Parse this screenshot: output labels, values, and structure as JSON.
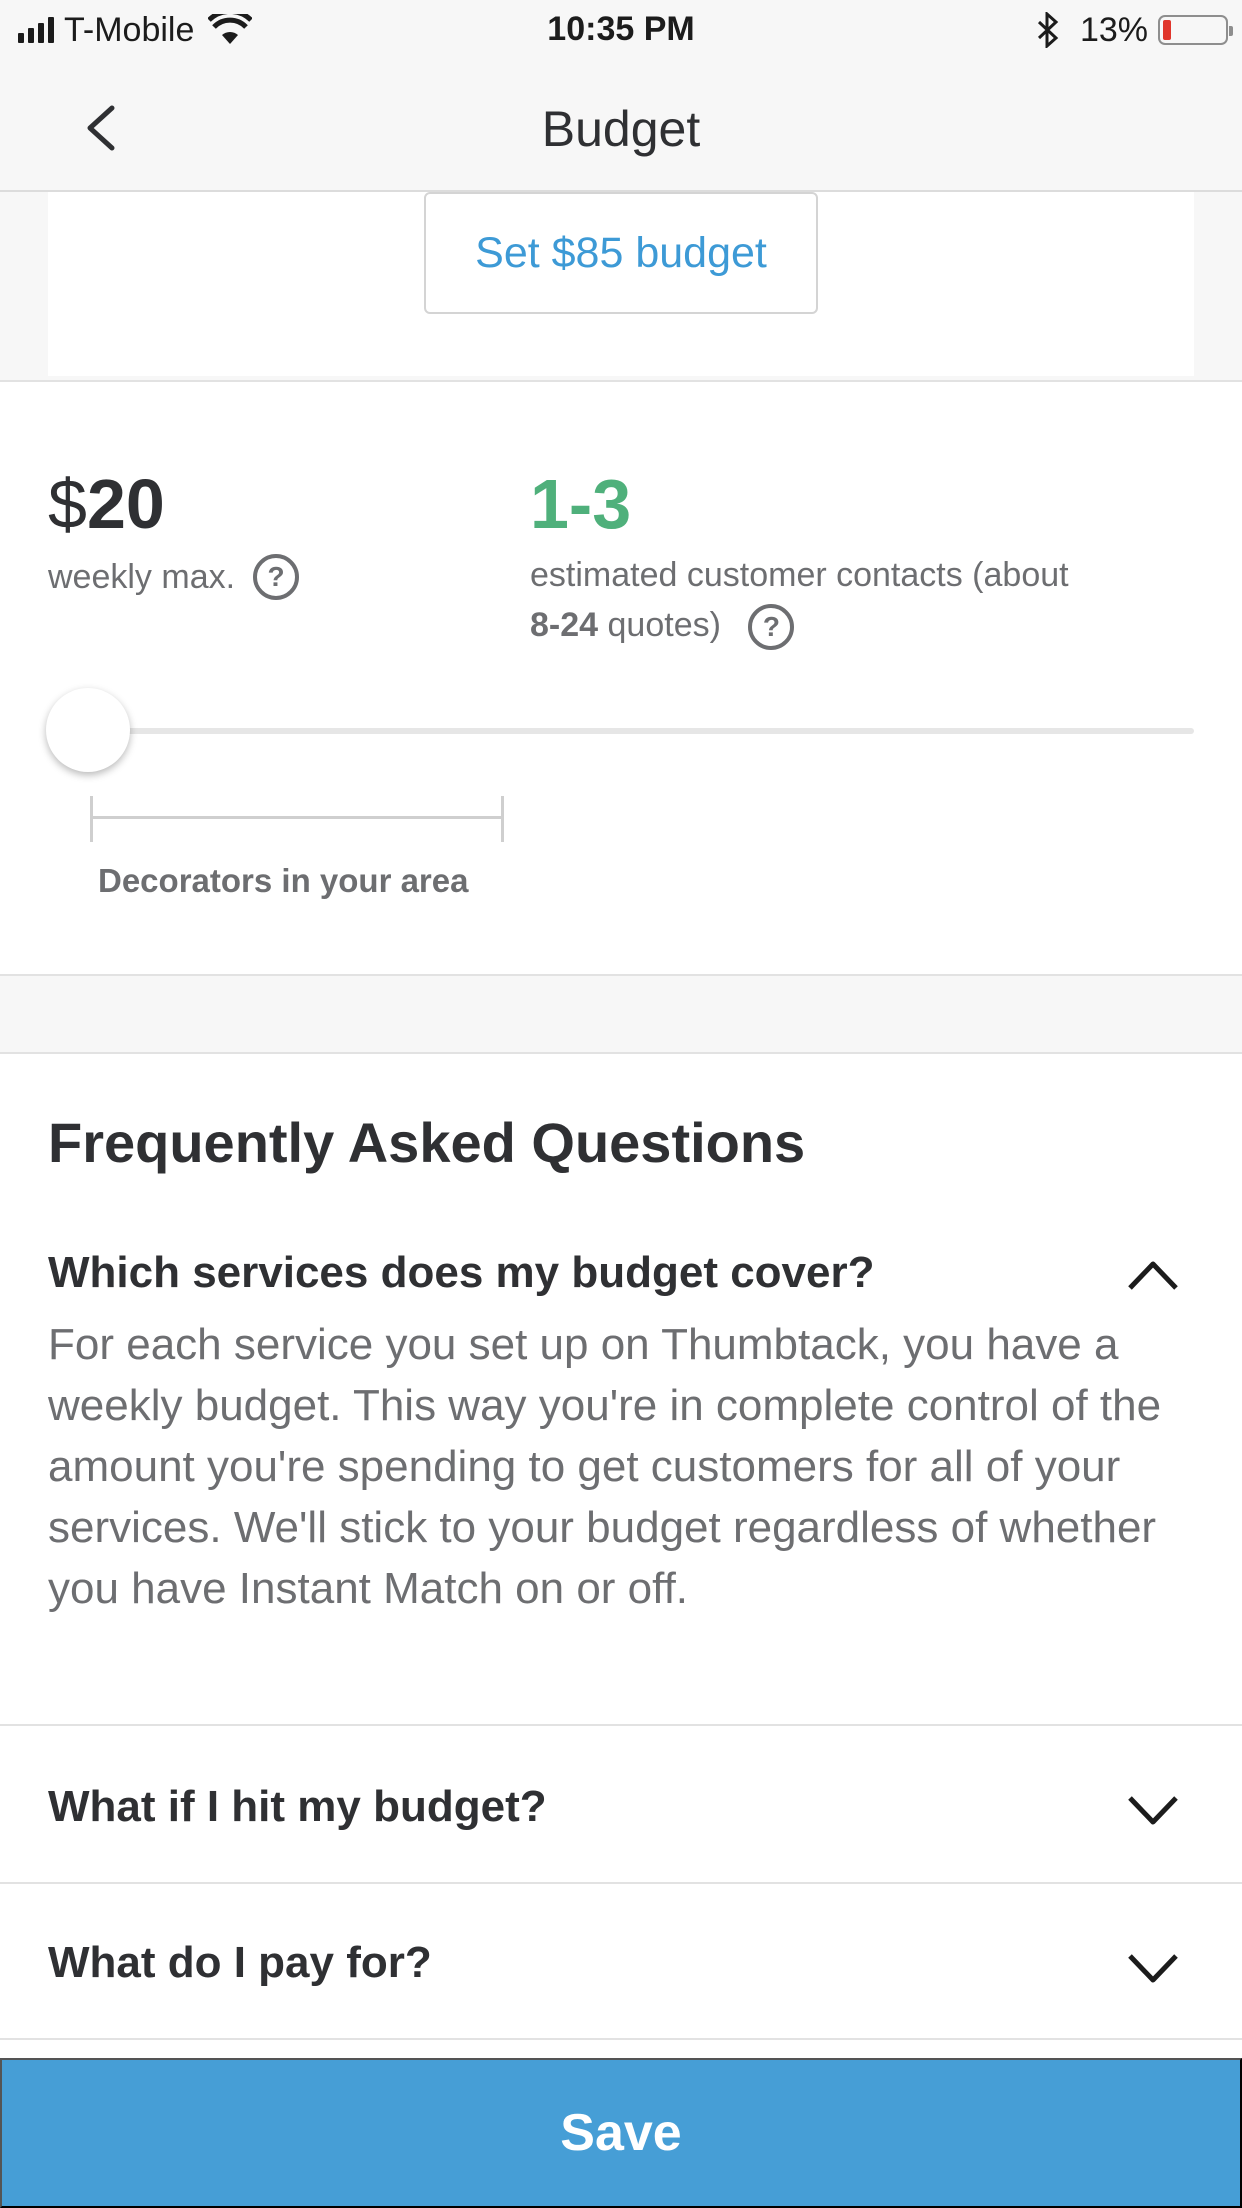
{
  "status_bar": {
    "carrier": "T-Mobile",
    "time": "10:35 PM",
    "battery_percent": "13%",
    "battery_level": 0.13,
    "icons": [
      "signal-icon",
      "wifi-icon",
      "bluetooth-icon",
      "battery-icon"
    ]
  },
  "nav": {
    "title": "Budget",
    "back_icon": "chevron-left-icon"
  },
  "top_card": {
    "set_budget_label": "Set $85 budget"
  },
  "budget": {
    "currency": "$",
    "amount": "20",
    "weekly_label": "weekly max.",
    "contacts_range": "1-3",
    "contacts_desc_prefix": "estimated customer contacts (about",
    "quotes_range": "8-24",
    "quotes_suffix": "quotes)",
    "slider_value_fraction": 0.0,
    "area_label": "Decorators in your area"
  },
  "faq": {
    "title": "Frequently Asked Questions",
    "items": [
      {
        "question": "Which services does my budget cover?",
        "expanded": true,
        "answer": "For each service you set up on Thumbtack, you have a weekly budget. This way you're in complete control of the amount you're spending to get customers for all of your services. We'll stick to your budget regardless of whether you have Instant Match on or off."
      },
      {
        "question": "What if I hit my budget?",
        "expanded": false
      },
      {
        "question": "What do I pay for?",
        "expanded": false
      }
    ]
  },
  "footer": {
    "save_label": "Save"
  },
  "colors": {
    "accent_blue": "#469ed6",
    "link_blue": "#3d9ad6",
    "green": "#4fb07b",
    "text_dark": "#2f3033",
    "text_gray": "#6d6e71"
  }
}
